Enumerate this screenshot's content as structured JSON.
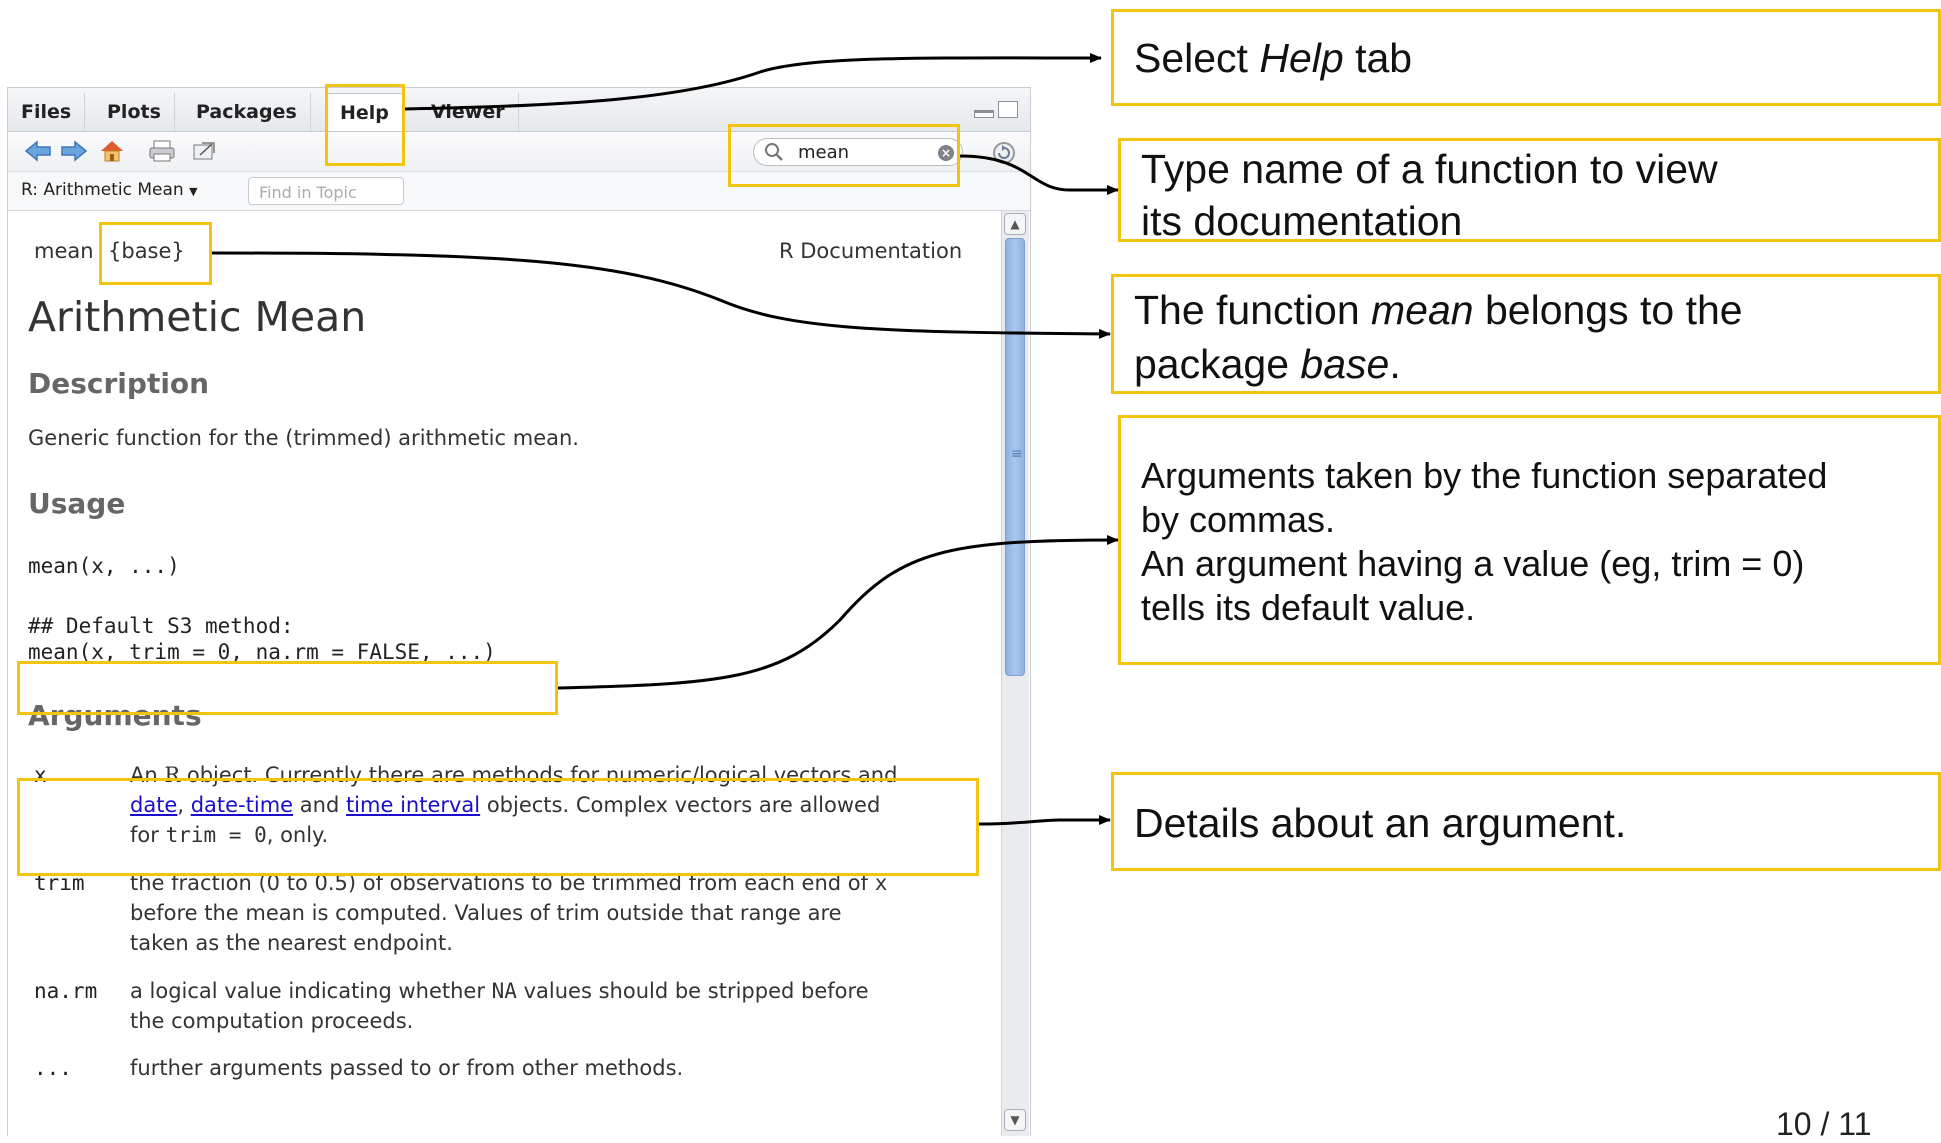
{
  "pane": {
    "tabs": [
      "Files",
      "Plots",
      "Packages",
      "Help",
      "Viewer"
    ],
    "active_tab": "Help",
    "search": {
      "value": "mean"
    },
    "topic_selector": "R: Arithmetic Mean",
    "find_in_topic_placeholder": "Find in Topic"
  },
  "doc": {
    "header_func": "mean",
    "header_pkg": "{base}",
    "header_right": "R Documentation",
    "title": "Arithmetic Mean",
    "description_heading": "Description",
    "description": "Generic function for the (trimmed) arithmetic mean.",
    "usage_heading": "Usage",
    "usage_line1": "mean(x, ...)",
    "usage_comment": "## Default S3 method:",
    "usage_line2": "mean(x, trim = 0, na.rm = FALSE, ...)",
    "arguments_heading": "Arguments",
    "args": [
      {
        "name": "x",
        "line1_a": "An ",
        "line1_r": "R",
        "line1_b": " object. Currently there are methods for numeric/logical vectors and",
        "link_date": "date",
        "sep1": ", ",
        "link_datetime": "date-time",
        "and": " and ",
        "link_interval": "time interval",
        "line2_rest": " objects. Complex vectors are allowed",
        "line3_a": "for ",
        "line3_code": "trim = 0",
        "line3_b": ", only."
      },
      {
        "name": "trim",
        "line1": "the fraction (0 to 0.5) of observations to be trimmed from each end of ",
        "line1_code": "x",
        "line2": "before the mean is computed. Values of trim outside that range are",
        "line3": "taken as the nearest endpoint."
      },
      {
        "name": "na.rm",
        "line1_a": "a logical value indicating whether ",
        "line1_code": "NA",
        "line1_b": " values should be stripped before",
        "line2": "the computation proceeds."
      },
      {
        "name": "...",
        "line1": "further arguments passed to or from other methods."
      }
    ]
  },
  "callouts": {
    "help_tab_a": "Select ",
    "help_tab_em": "Help",
    "help_tab_b": " tab",
    "search_1": "Type name of a function to view",
    "search_2": "its documentation",
    "pkg_1a": "The function ",
    "pkg_1em": "mean",
    "pkg_1b": " belongs to the",
    "pkg_2a": "package ",
    "pkg_2em": "base",
    "pkg_2b": ".",
    "args_1": "Arguments taken by the function separated",
    "args_2": "by commas.",
    "args_3": "An argument having a value (eg, trim = 0)",
    "args_4": "tells its default value.",
    "details": "Details about an argument."
  },
  "footer": "10 / 11",
  "colors": {
    "highlight": "#f2c40f",
    "link": "#1a0dce",
    "scroll_thumb": "#a9c6ec"
  }
}
